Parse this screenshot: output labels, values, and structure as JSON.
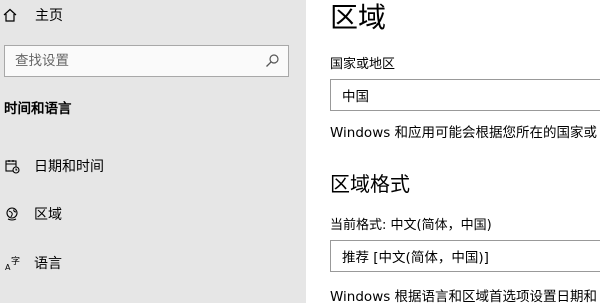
{
  "sidebar": {
    "home_label": "主页",
    "search_placeholder": "查找设置",
    "section_title": "时间和语言",
    "items": [
      {
        "label": "日期和时间",
        "icon": "calendar-clock-icon"
      },
      {
        "label": "区域",
        "icon": "globe-icon"
      },
      {
        "label": "语言",
        "icon": "language-icon"
      }
    ]
  },
  "main": {
    "title": "区域",
    "country_label": "国家或地区",
    "country_value": "中国",
    "country_desc": "Windows 和应用可能会根据您所在的国家或",
    "format_heading": "区域格式",
    "current_format": "当前格式: 中文(简体，中国)",
    "format_value": "推荐 [中文(简体，中国)]",
    "format_desc": "Windows 根据语言和区域首选项设置日期和"
  }
}
